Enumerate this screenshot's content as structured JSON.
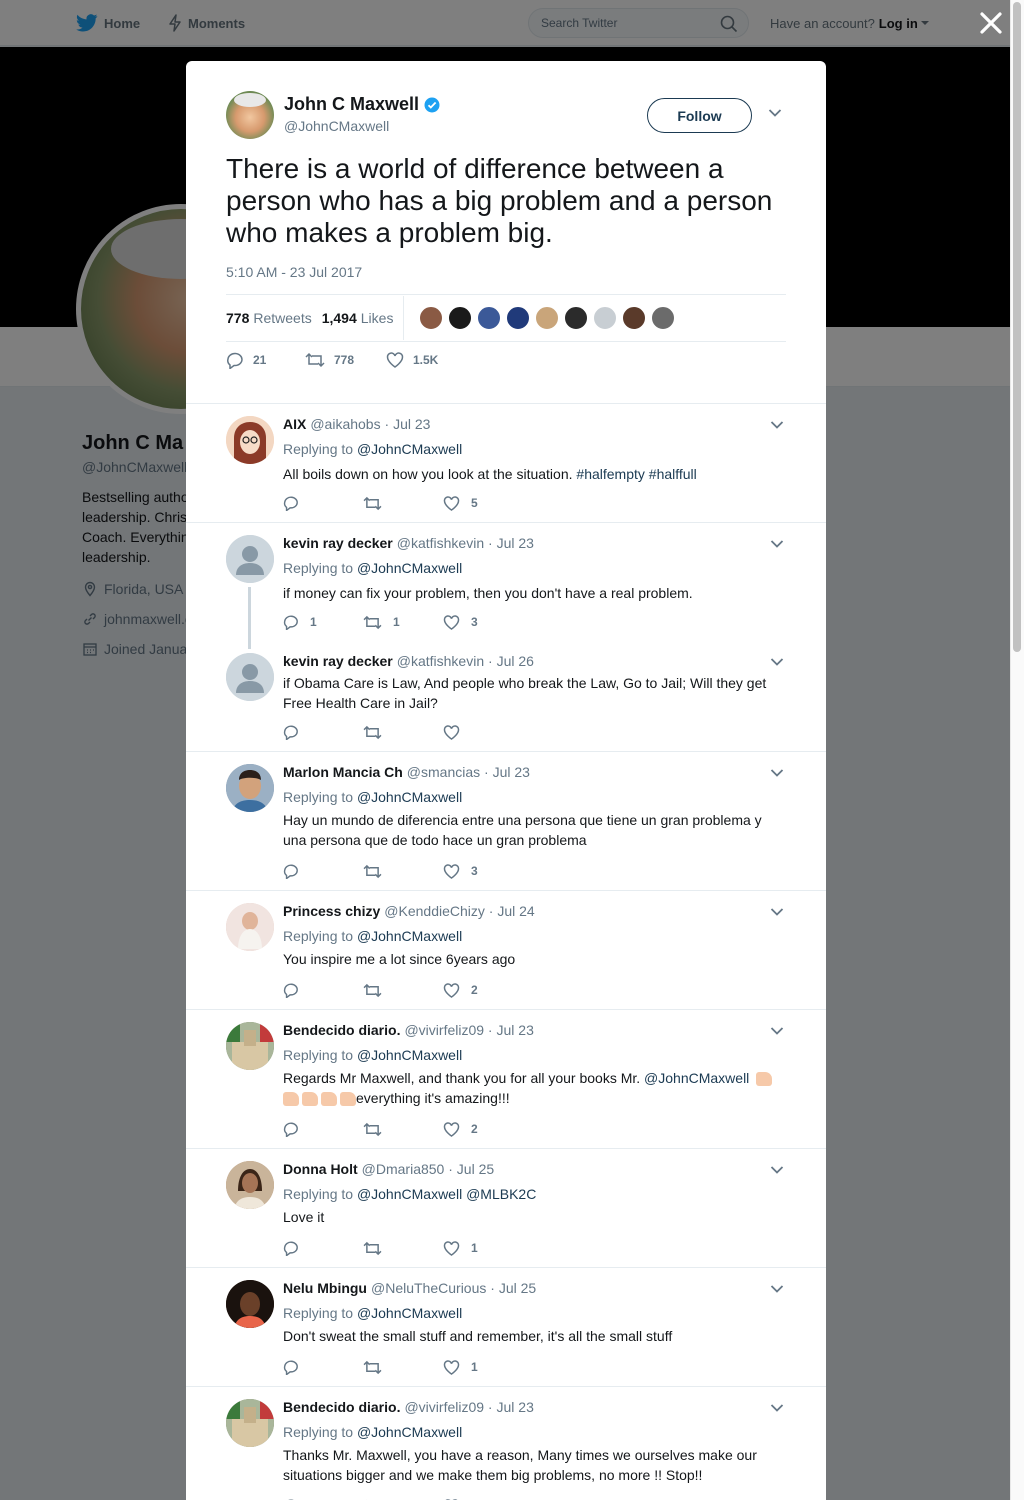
{
  "topbar": {
    "home_label": "Home",
    "moments_label": "Moments",
    "search_placeholder": "Search Twitter",
    "account_prompt": "Have an account?",
    "login_label": "Log in"
  },
  "profile": {
    "name": "John C Ma",
    "handle": "@JohnCMaxwell",
    "bio": "Bestselling autho\nleadership. Chris\nCoach. Everythin\nleadership.",
    "location": "Florida, USA",
    "website": "johnmaxwell.c",
    "joined": "Joined Janua"
  },
  "tweet": {
    "author_name": "John C Maxwell",
    "author_handle": "@JohnCMaxwell",
    "follow_label": "Follow",
    "text": "There is a world of difference between a person who has a big problem and a person who makes a problem big.",
    "timestamp": "5:10 AM - 23 Jul 2017",
    "retweets_count": "778",
    "retweets_label": "Retweets",
    "likes_count": "1,494",
    "likes_label": "Likes",
    "reply_count": "21",
    "retweet_count": "778",
    "like_count": "1.5K",
    "liker_colors": [
      "#8a5a44",
      "#1a1a1a",
      "#3b5998",
      "#203a7a",
      "#c9a57a",
      "#2b2b2b",
      "#c8ced3",
      "#5a3a2a",
      "#6b6b6b"
    ]
  },
  "replies": [
    {
      "name": "AIX",
      "handle": "@aikahobs",
      "date": "Jul 23",
      "replying_prefix": "Replying to",
      "replying_to": "@JohnCMaxwell",
      "text": "All boils down on how you look at the situation.",
      "tags": "#halfempty #halffull",
      "reply_count": "",
      "retweet_count": "",
      "like_count": "5",
      "avatar_color": "#c0563f"
    },
    {
      "name": "kevin ray decker",
      "handle": "@katfishkevin",
      "date": "Jul 23",
      "replying_prefix": "Replying to",
      "replying_to": "@JohnCMaxwell",
      "text": "if money can fix your problem, then you don't have a real problem.",
      "reply_count": "1",
      "retweet_count": "1",
      "like_count": "3",
      "avatar_color": "#ccd6dd"
    },
    {
      "name": "kevin ray decker",
      "handle": "@katfishkevin",
      "date": "Jul 26",
      "text": "if Obama Care is Law, And people who break the Law, Go to Jail; Will they get Free Health Care in Jail?",
      "reply_count": "",
      "retweet_count": "",
      "like_count": "",
      "avatar_color": "#ccd6dd"
    },
    {
      "name": "Marlon Mancia Ch",
      "handle": "@smancias",
      "date": "Jul 23",
      "replying_prefix": "Replying to",
      "replying_to": "@JohnCMaxwell",
      "text": "Hay un mundo de diferencia entre una persona que tiene un gran problema y una persona que de todo hace un gran problema",
      "reply_count": "",
      "retweet_count": "",
      "like_count": "3",
      "avatar_color": "#7a8fa8"
    },
    {
      "name": "Princess chizy",
      "handle": "@KenddieChizy",
      "date": "Jul 24",
      "replying_prefix": "Replying to",
      "replying_to": "@JohnCMaxwell",
      "text": "You inspire me a lot since 6years ago",
      "reply_count": "",
      "retweet_count": "",
      "like_count": "2",
      "avatar_color": "#e3c9c0"
    },
    {
      "name": "Bendecido diario.",
      "handle": "@vivirfeliz09",
      "date": "Jul 23",
      "replying_prefix": "Replying to",
      "replying_to": "@JohnCMaxwell",
      "text_a": "Regards Mr Maxwell, and thank you for all your books Mr.",
      "mention": "@JohnCMaxwell",
      "text_b": "everything it's amazing!!!",
      "reply_count": "",
      "retweet_count": "",
      "like_count": "2",
      "avatar_color": "#6e7a5a"
    },
    {
      "name": "Donna Holt",
      "handle": "@Dmaria850",
      "date": "Jul 25",
      "replying_prefix": "Replying to",
      "replying_to": "@JohnCMaxwell",
      "replying_to_2": "@MLBK2C",
      "text": "Love it",
      "reply_count": "",
      "retweet_count": "",
      "like_count": "1",
      "avatar_color": "#b08868"
    },
    {
      "name": "Nelu Mbingu",
      "handle": "@NeluTheCurious",
      "date": "Jul 25",
      "replying_prefix": "Replying to",
      "replying_to": "@JohnCMaxwell",
      "text": "Don't sweat the small stuff and remember, it's all the small stuff",
      "reply_count": "",
      "retweet_count": "",
      "like_count": "1",
      "avatar_color": "#3a2418"
    },
    {
      "name": "Bendecido diario.",
      "handle": "@vivirfeliz09",
      "date": "Jul 23",
      "replying_prefix": "Replying to",
      "replying_to": "@JohnCMaxwell",
      "text": "Thanks Mr. Maxwell, you have a reason, Many times we ourselves make our situations bigger and we make them big problems, no more !! Stop!!",
      "reply_count": "",
      "retweet_count": "",
      "like_count": "",
      "avatar_color": "#6e7a5a"
    }
  ]
}
